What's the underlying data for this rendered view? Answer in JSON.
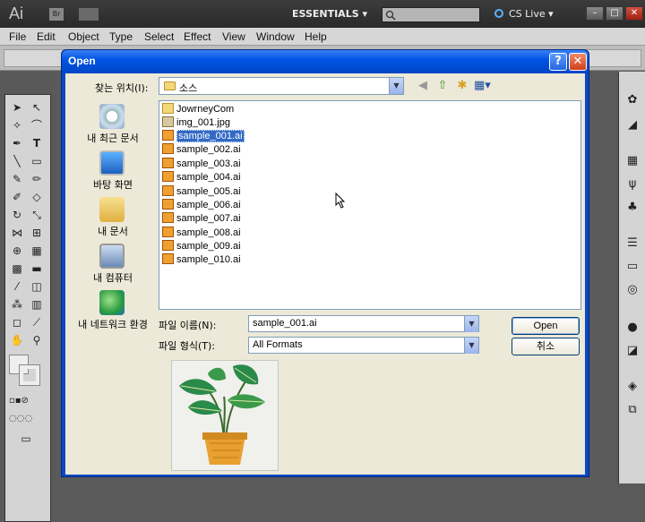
{
  "app": {
    "logo": "Ai",
    "bridge": "Br",
    "workspace": "ESSENTIALS",
    "cs_live": "CS Live",
    "window_buttons": [
      "–",
      "□",
      "✕"
    ]
  },
  "menu": [
    "File",
    "Edit",
    "Object",
    "Type",
    "Select",
    "Effect",
    "View",
    "Window",
    "Help"
  ],
  "dialog": {
    "title": "Open",
    "help": "?",
    "close": "✕",
    "look_in_label": "찾는 위치(I):",
    "look_in_value": "소스",
    "places": [
      "내 최근 문서",
      "바탕 화면",
      "내 문서",
      "내 컴퓨터",
      "내 네트워크 환경"
    ],
    "files": [
      {
        "name": "JowrneyCom",
        "kind": "folder"
      },
      {
        "name": "img_001.jpg",
        "kind": "jpg"
      },
      {
        "name": "sample_001.ai",
        "kind": "ai",
        "selected": true
      },
      {
        "name": "sample_002.ai",
        "kind": "ai"
      },
      {
        "name": "sample_003.ai",
        "kind": "ai"
      },
      {
        "name": "sample_004.ai",
        "kind": "ai"
      },
      {
        "name": "sample_005.ai",
        "kind": "ai"
      },
      {
        "name": "sample_006.ai",
        "kind": "ai"
      },
      {
        "name": "sample_007.ai",
        "kind": "ai"
      },
      {
        "name": "sample_008.ai",
        "kind": "ai"
      },
      {
        "name": "sample_009.ai",
        "kind": "ai"
      },
      {
        "name": "sample_010.ai",
        "kind": "ai"
      }
    ],
    "file_name_label": "파일 이름(N):",
    "file_name_value": "sample_001.ai",
    "file_type_label": "파일 형식(T):",
    "file_type_value": "All Formats",
    "open_button": "Open",
    "cancel_button": "취소"
  },
  "colors": {
    "titlebar": "#0054e3",
    "selection": "#316ac5",
    "dialog_face": "#ece9d8"
  }
}
